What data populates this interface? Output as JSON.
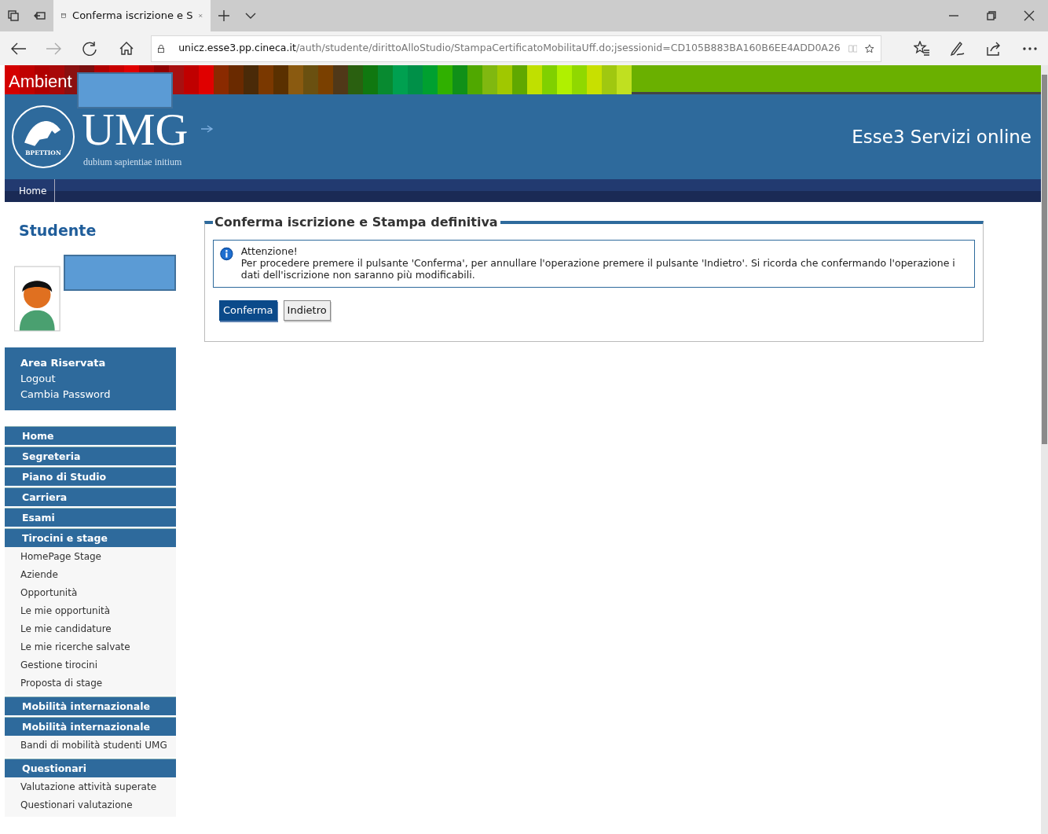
{
  "browser": {
    "tab_title": "Conferma iscrizione e S",
    "url_host": "unicz.esse3.pp.cineca.it",
    "url_path": "/auth/studente/dirittoAlloStudio/StampaCertificatoMobilitaUff.do;jsessionid=CD105B883BA160B6EE4ADD0A26"
  },
  "banner": {
    "label": "Ambient"
  },
  "header": {
    "logo_text": "UMG",
    "motto": "dubium sapientiae initium",
    "seal_text": "BPETTION",
    "service_title": "Esse3 Servizi online"
  },
  "nav": [
    {
      "label": "Home"
    }
  ],
  "sidebar": {
    "title": "Studente",
    "reserved": {
      "title": "Area Riservata",
      "links": [
        "Logout",
        "Cambia Password"
      ]
    },
    "menu": [
      {
        "label": "Home"
      },
      {
        "label": "Segreteria"
      },
      {
        "label": "Piano di Studio"
      },
      {
        "label": "Carriera"
      },
      {
        "label": "Esami"
      },
      {
        "label": "Tirocini e stage",
        "children": [
          "HomePage Stage",
          "Aziende",
          "Opportunità",
          "Le mie opportunità",
          "Le mie candidature",
          "Le mie ricerche salvate",
          "Gestione tirocini",
          "Proposta di stage"
        ]
      },
      {
        "label": "Mobilità internazionale"
      },
      {
        "label": "Mobilità internazionale",
        "children": [
          "Bandi di mobilità studenti UMG"
        ]
      },
      {
        "label": "Questionari",
        "children": [
          "Valutazione attività superate",
          "Questionari valutazione"
        ]
      }
    ]
  },
  "content": {
    "title": "Conferma iscrizione e Stampa definitiva",
    "alert": {
      "heading": "Attenzione!",
      "text": "Per procedere premere il pulsante 'Conferma', per annullare l'operazione premere il pulsante 'Indietro'. Si ricorda che confermando l'operazione i dati dell'iscrizione non saranno più modificabili."
    },
    "buttons": [
      {
        "label": "Conferma",
        "kind": "primary"
      },
      {
        "label": "Indietro",
        "kind": "secondary"
      }
    ]
  }
}
